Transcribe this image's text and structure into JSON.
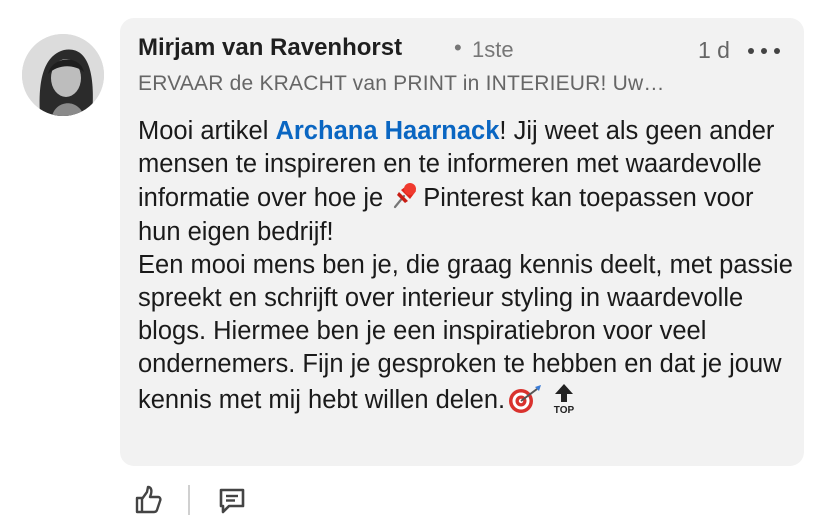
{
  "comment": {
    "author_name": "Mirjam van Ravenhorst",
    "separator": "•",
    "connection_degree": "1ste",
    "timestamp": "1 d",
    "headline": "ERVAAR de KRACHT van PRINT in INTERIEUR! Uw…",
    "body": {
      "p1_before_mention": "Mooi artikel ",
      "mention": "Archana Haarnack",
      "p1_after_mention": "! Jij weet als geen ander mensen te inspireren en te informeren met waardevolle informatie over hoe je",
      "p1_after_emoji": "Pinterest kan toepassen voor hun eigen bedrijf!",
      "p2": "Een mooi mens ben je, die graag kennis deelt, met passie spreekt en schrijft over interieur styling in waardevolle blogs. Hiermee ben je een inspiratiebron voor veel ondernemers. Fijn je gesproken te hebben en dat je jouw kennis met mij hebt willen delen.",
      "top_emoji_text": "TOP"
    },
    "icons": {
      "more": "more-horizontal-icon",
      "pin": "pushpin-icon",
      "dart": "direct-hit-icon",
      "top": "top-arrow-icon",
      "like": "like-icon",
      "reply": "reply-icon"
    },
    "colors": {
      "bubble": "#f2f2f2",
      "mention": "#0a66c2",
      "text": "#1a1a1a",
      "muted": "#666666"
    }
  }
}
